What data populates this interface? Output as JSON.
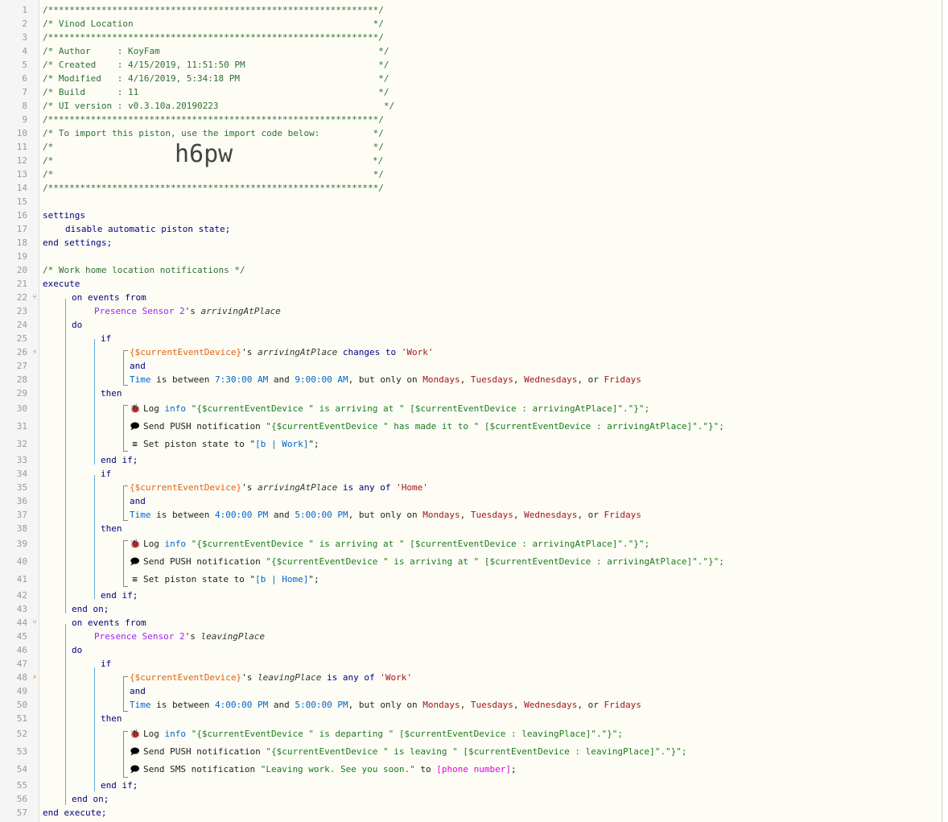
{
  "header": {
    "l1": "/**************************************************************/",
    "l2": "/* Vinod Location                                             */",
    "l3": "/**************************************************************/",
    "l4": "/* Author     : KoyFam                                         */",
    "l5": "/* Created    : 4/15/2019, 11:51:50 PM                         */",
    "l6": "/* Modified   : 4/16/2019, 5:34:18 PM                          */",
    "l7": "/* Build      : 11                                             */",
    "l8": "/* UI version : v0.3.10a.20190223                               */",
    "l9": "/**************************************************************/",
    "l10": "/* To import this piston, use the import code below:          */",
    "l11": "/*                                                            */",
    "l12a": "/*",
    "l12b": "*/",
    "import_code": "h6pw",
    "l13": "/*                                                            */",
    "l14": "/**************************************************************/"
  },
  "settings": {
    "open": "settings",
    "body": "disable automatic piston state;",
    "close": "end settings;"
  },
  "comment": "/* Work home location notifications */",
  "execute_open": "execute",
  "execute_close": "end execute;",
  "kw": {
    "on_events_from": "on events from",
    "do": "do",
    "if": "if",
    "and": "and",
    "then": "then",
    "end_if": "end if;",
    "end_on": "end on;"
  },
  "device": "Presence Sensor 2",
  "poss": "'s ",
  "attr_arriving": "arrivingAtPlace",
  "attr_leaving": "leavingPlace",
  "cur_dev": "{$currentEventDevice}",
  "blk1": {
    "cond1_op": " changes to ",
    "cond1_val": "'Work'",
    "time_a": "7:30:00 AM",
    "time_b": "9:00:00 AM",
    "log": "\"{$currentEventDevice \" is arriving at \" [$currentEventDevice : arrivingAtPlace]\".\"}\";",
    "push": "\"{$currentEventDevice \" has made it to \" [$currentEventDevice : arrivingAtPlace]\".\"}\";",
    "state_val": "Work"
  },
  "blk2": {
    "cond1_op": " is any of ",
    "cond1_val": "'Home'",
    "time_a": "4:00:00 PM",
    "time_b": "5:00:00 PM",
    "log": "\"{$currentEventDevice \" is arriving at \" [$currentEventDevice : arrivingAtPlace]\".\"}\";",
    "push": "\"{$currentEventDevice \" is arriving at \" [$currentEventDevice : arrivingAtPlace]\".\"}\";",
    "state_val": "Home"
  },
  "blk3": {
    "cond1_op": " is any of ",
    "cond1_val": "'Work'",
    "time_a": "4:00:00 PM",
    "time_b": "5:00:00 PM",
    "log": "\"{$currentEventDevice \" is departing \" [$currentEventDevice : leavingPlace]\".\"}\";",
    "push": "\"{$currentEventDevice \" is leaving \" [$currentEventDevice : leavingPlace]\".\"}\";",
    "sms_msg": "\"Leaving work. See you soon.\"",
    "sms_to": " to ",
    "sms_target": "[phone number]"
  },
  "time": {
    "label": "Time",
    "between": " is between ",
    "and": " and ",
    "but": ", but only on ",
    "d1": "Mondays",
    "d2": "Tuesdays",
    "d3": "Wednesdays",
    "or": ", or ",
    "d4": "Fridays",
    "sep": ", "
  },
  "stmt": {
    "log": "Log ",
    "info": "info",
    "push": "Send PUSH notification ",
    "sms": "Send SMS notification ",
    "set_state": "Set piston state to \"",
    "b_open": "[b | ",
    "b_close": "]",
    "state_end": "\";"
  },
  "line_numbers": [
    "1",
    "2",
    "3",
    "4",
    "5",
    "6",
    "7",
    "8",
    "9",
    "10",
    "11",
    "12",
    "13",
    "14",
    "15",
    "16",
    "17",
    "18",
    "19",
    "20",
    "21",
    "22",
    "23",
    "24",
    "25",
    "26",
    "27",
    "28",
    "29",
    "30",
    "31",
    "32",
    "33",
    "34",
    "35",
    "36",
    "37",
    "38",
    "39",
    "40",
    "41",
    "42",
    "43",
    "44",
    "45",
    "46",
    "47",
    "48",
    "49",
    "50",
    "51",
    "52",
    "53",
    "54",
    "55",
    "56",
    "57"
  ]
}
